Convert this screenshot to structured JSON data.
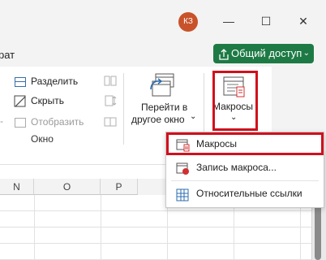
{
  "titlebar": {
    "avatar_initials": "КЗ",
    "minimize_glyph": "—",
    "maximize_glyph": "☐",
    "close_glyph": "✕"
  },
  "tabs": {
    "partial_tab": "рат"
  },
  "share": {
    "label": "Общий доступ",
    "icon": "share-icon",
    "chevron": "⌄",
    "color": "#1e7a45"
  },
  "ribbon": {
    "window_group": {
      "split_label": "Разделить",
      "hide_label": "Скрыть",
      "unhide_label": "Отобразить",
      "group_label": "Окно"
    },
    "switch_windows": {
      "line1": "Перейти в",
      "line2": "другое окно",
      "chevron": "⌄"
    },
    "macros": {
      "label": "Макросы",
      "chevron": "⌄",
      "highlight_color": "#d20f1c"
    }
  },
  "macros_menu": {
    "items": [
      {
        "label": "Макросы",
        "icon": "macros-icon"
      },
      {
        "label": "Запись макроса...",
        "icon": "record-macro-icon"
      },
      {
        "label": "Относительные ссылки",
        "icon": "relative-references-icon"
      }
    ]
  },
  "sheet": {
    "columns": [
      "N",
      "O",
      "P"
    ]
  }
}
